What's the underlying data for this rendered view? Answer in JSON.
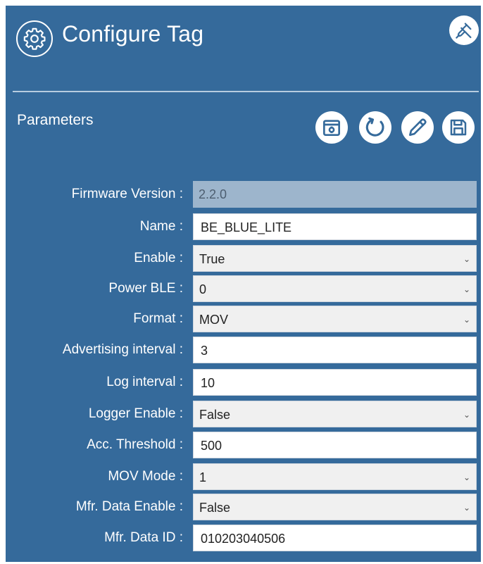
{
  "header": {
    "title": "Configure Tag",
    "icon": "gear-icon",
    "action_icon": "unlink-icon"
  },
  "section": {
    "title": "Parameters",
    "toolbar": [
      "settings-calendar-icon",
      "refresh-icon",
      "edit-icon",
      "save-icon"
    ]
  },
  "fields": {
    "firmware_version": {
      "label": "Firmware Version :",
      "value": "2.2.0"
    },
    "name": {
      "label": "Name :",
      "value": "BE_BLUE_LITE"
    },
    "enable": {
      "label": "Enable :",
      "value": "True"
    },
    "power_ble": {
      "label": "Power BLE :",
      "value": "0"
    },
    "format": {
      "label": "Format :",
      "value": "MOV"
    },
    "advertising_interval": {
      "label": "Advertising interval :",
      "value": "3"
    },
    "log_interval": {
      "label": "Log interval :",
      "value": "10"
    },
    "logger_enable": {
      "label": "Logger Enable :",
      "value": "False"
    },
    "acc_threshold": {
      "label": "Acc. Threshold :",
      "value": "500"
    },
    "mov_mode": {
      "label": "MOV Mode :",
      "value": "1"
    },
    "mfr_data_enable": {
      "label": "Mfr. Data Enable :",
      "value": "False"
    },
    "mfr_data_id": {
      "label": "Mfr. Data ID :",
      "value": "010203040506"
    }
  },
  "colors": {
    "panel_bg": "#356a9b",
    "readonly_bg": "#9db5cc",
    "input_bg": "#ffffff",
    "select_bg": "#f0f0f0"
  }
}
